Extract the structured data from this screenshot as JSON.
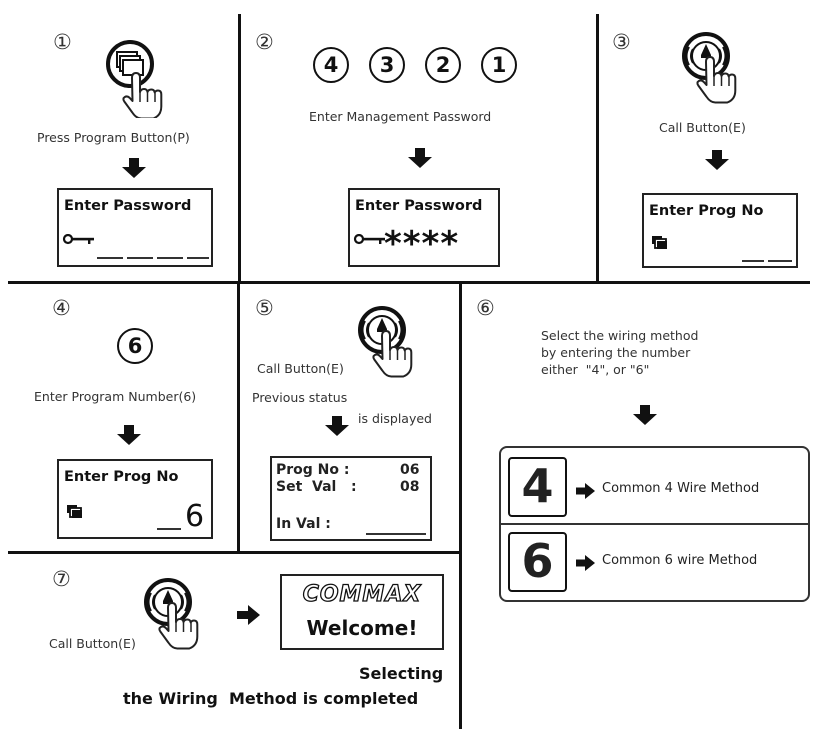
{
  "steps": {
    "s1": {
      "num": "①",
      "caption": "Press Program Button(P)",
      "lcd_title": "Enter Password"
    },
    "s2": {
      "num": "②",
      "digits": [
        "4",
        "3",
        "2",
        "1"
      ],
      "caption": "Enter Management Password",
      "lcd_title": "Enter Password",
      "lcd_value": "****"
    },
    "s3": {
      "num": "③",
      "caption": "Call Button(E)",
      "lcd_title": "Enter Prog  No"
    },
    "s4": {
      "num": "④",
      "digit": "6",
      "caption": "Enter Program Number(6)",
      "lcd_title": "Enter Prog  No",
      "lcd_value": "6"
    },
    "s5": {
      "num": "⑤",
      "caption": "Call Button(E)",
      "caption2a": "Previous status",
      "caption2b": "is displayed",
      "lcd": {
        "row1_label": "Prog No :",
        "row1_value": "06",
        "row2_label": "Set  Val   :",
        "row2_value": "08",
        "row3_label": "In Val :"
      }
    },
    "s6": {
      "num": "⑥",
      "text_l1": "Select the wiring method",
      "text_l2": "by entering the number",
      "text_l3": "either  \"4\", or \"6\"",
      "options": [
        {
          "digit": "4",
          "label": "Common 4 Wire Method"
        },
        {
          "digit": "6",
          "label": "Common 6 wire Method"
        }
      ]
    },
    "s7": {
      "num": "⑦",
      "caption": "Call Button(E)",
      "brand": "COMMAX",
      "welcome": "Welcome!",
      "done_l1": "Selecting",
      "done_l2": "the Wiring  Method is completed"
    }
  },
  "icons": {
    "program_button": "program-button-icon",
    "call_button": "call-button-icon",
    "key": "key-icon",
    "copy": "copy-icon",
    "down_arrow": "down-arrow-icon",
    "right_arrow": "right-arrow-icon"
  }
}
